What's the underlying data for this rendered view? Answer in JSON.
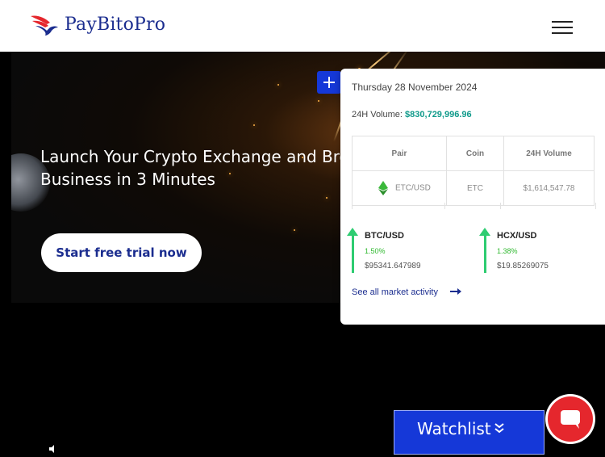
{
  "header": {
    "logo_text": "PayBitoPro",
    "menu_icon": "hamburger-menu-icon"
  },
  "hero": {
    "title": "Launch Your Crypto Exchange and Broke Business in 3 Minutes",
    "title_line1": "Launch Your Crypto Exchange and Broke",
    "title_line2": "Business in 3 Minutes",
    "cta_label": "Start free trial now"
  },
  "market_panel": {
    "date": "Thursday 28 November 2024",
    "volume_label": "24H Volume:",
    "volume_value": "$830,729,996.96",
    "columns": [
      "Pair",
      "Coin",
      "24H Volume"
    ],
    "rows": [
      {
        "pair": "ETC/USD",
        "coin": "ETC",
        "volume": "$1,614,547.78"
      }
    ],
    "tickers": [
      {
        "symbol": "BTC/USD",
        "change": "1.50%",
        "price": "$95341.647989"
      },
      {
        "symbol": "HCX/USD",
        "change": "1.38%",
        "price": "$19.85269075"
      }
    ],
    "see_all_label": "See all market activity"
  },
  "watchlist": {
    "label": "Watchlist"
  },
  "colors": {
    "brand_blue": "#1b2d8f",
    "accent_blue": "#1538d8",
    "teal": "#0f9a8a",
    "green": "#2ecc71",
    "chat_red": "#e5272d"
  }
}
